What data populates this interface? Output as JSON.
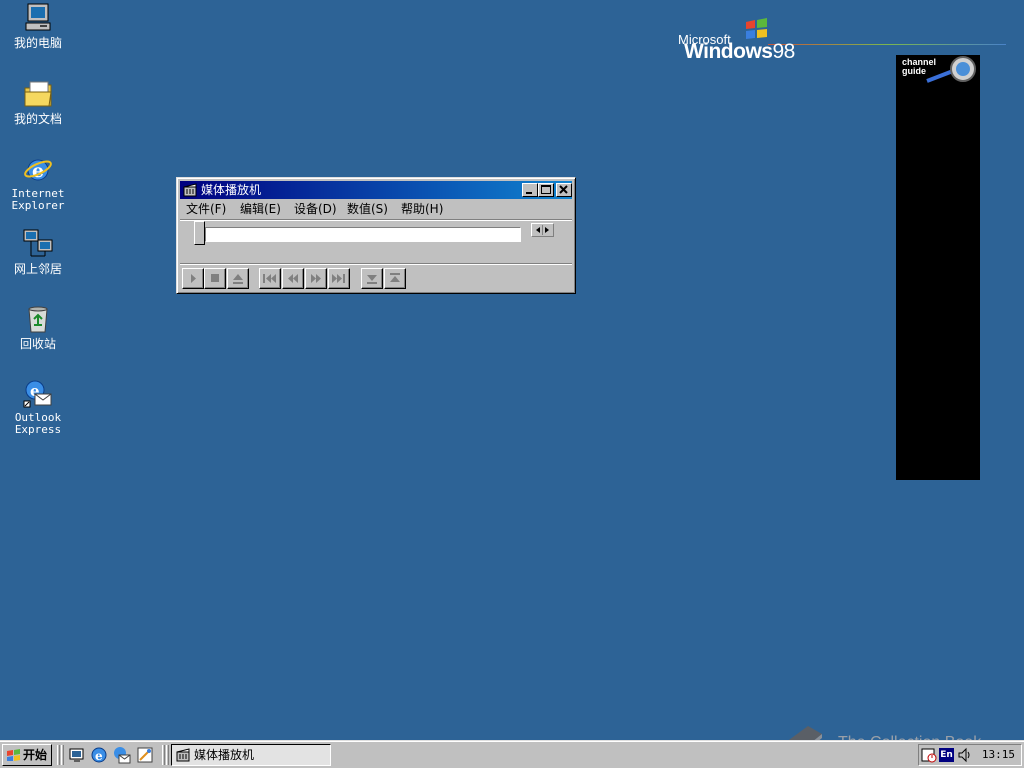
{
  "desktop": {
    "icons": [
      {
        "label": "我的电脑",
        "icon": "my-computer-icon"
      },
      {
        "label": "我的文档",
        "icon": "my-documents-icon"
      },
      {
        "label": "Internet\nExplorer",
        "icon": "internet-explorer-icon"
      },
      {
        "label": "网上邻居",
        "icon": "network-neighborhood-icon"
      },
      {
        "label": "回收站",
        "icon": "recycle-bin-icon"
      },
      {
        "label": "Outlook\nExpress",
        "icon": "outlook-express-icon"
      }
    ],
    "logo": {
      "microsoft": "Microsoft",
      "windows": "Windows",
      "version": "98"
    },
    "channel_bar": {
      "guide_line1": "channel",
      "guide_line2": "guide"
    }
  },
  "media_player": {
    "title": "媒体播放机",
    "menus": [
      "文件(F)",
      "编辑(E)",
      "设备(D)",
      "数值(S)",
      "帮助(H)"
    ],
    "controls": [
      "play-icon",
      "stop-icon",
      "eject-icon",
      "prev-mark-icon",
      "rewind-icon",
      "fast-forward-icon",
      "next-mark-icon",
      "start-selection-icon",
      "end-selection-icon"
    ]
  },
  "taskbar": {
    "start_label": "开始",
    "quick_launch": [
      "show-desktop-icon",
      "internet-explorer-icon",
      "outlook-express-icon",
      "channels-icon"
    ],
    "tasks": [
      {
        "label": "媒体播放机",
        "icon": "media-player-icon"
      }
    ],
    "tray": {
      "lang": "En",
      "clock": "13:15"
    }
  },
  "watermark": {
    "text": "The Collection Book"
  },
  "colors": {
    "desktop": "#2d6396",
    "titlebar_start": "#000080",
    "titlebar_end": "#1084d0",
    "face": "#c0c0c0"
  }
}
